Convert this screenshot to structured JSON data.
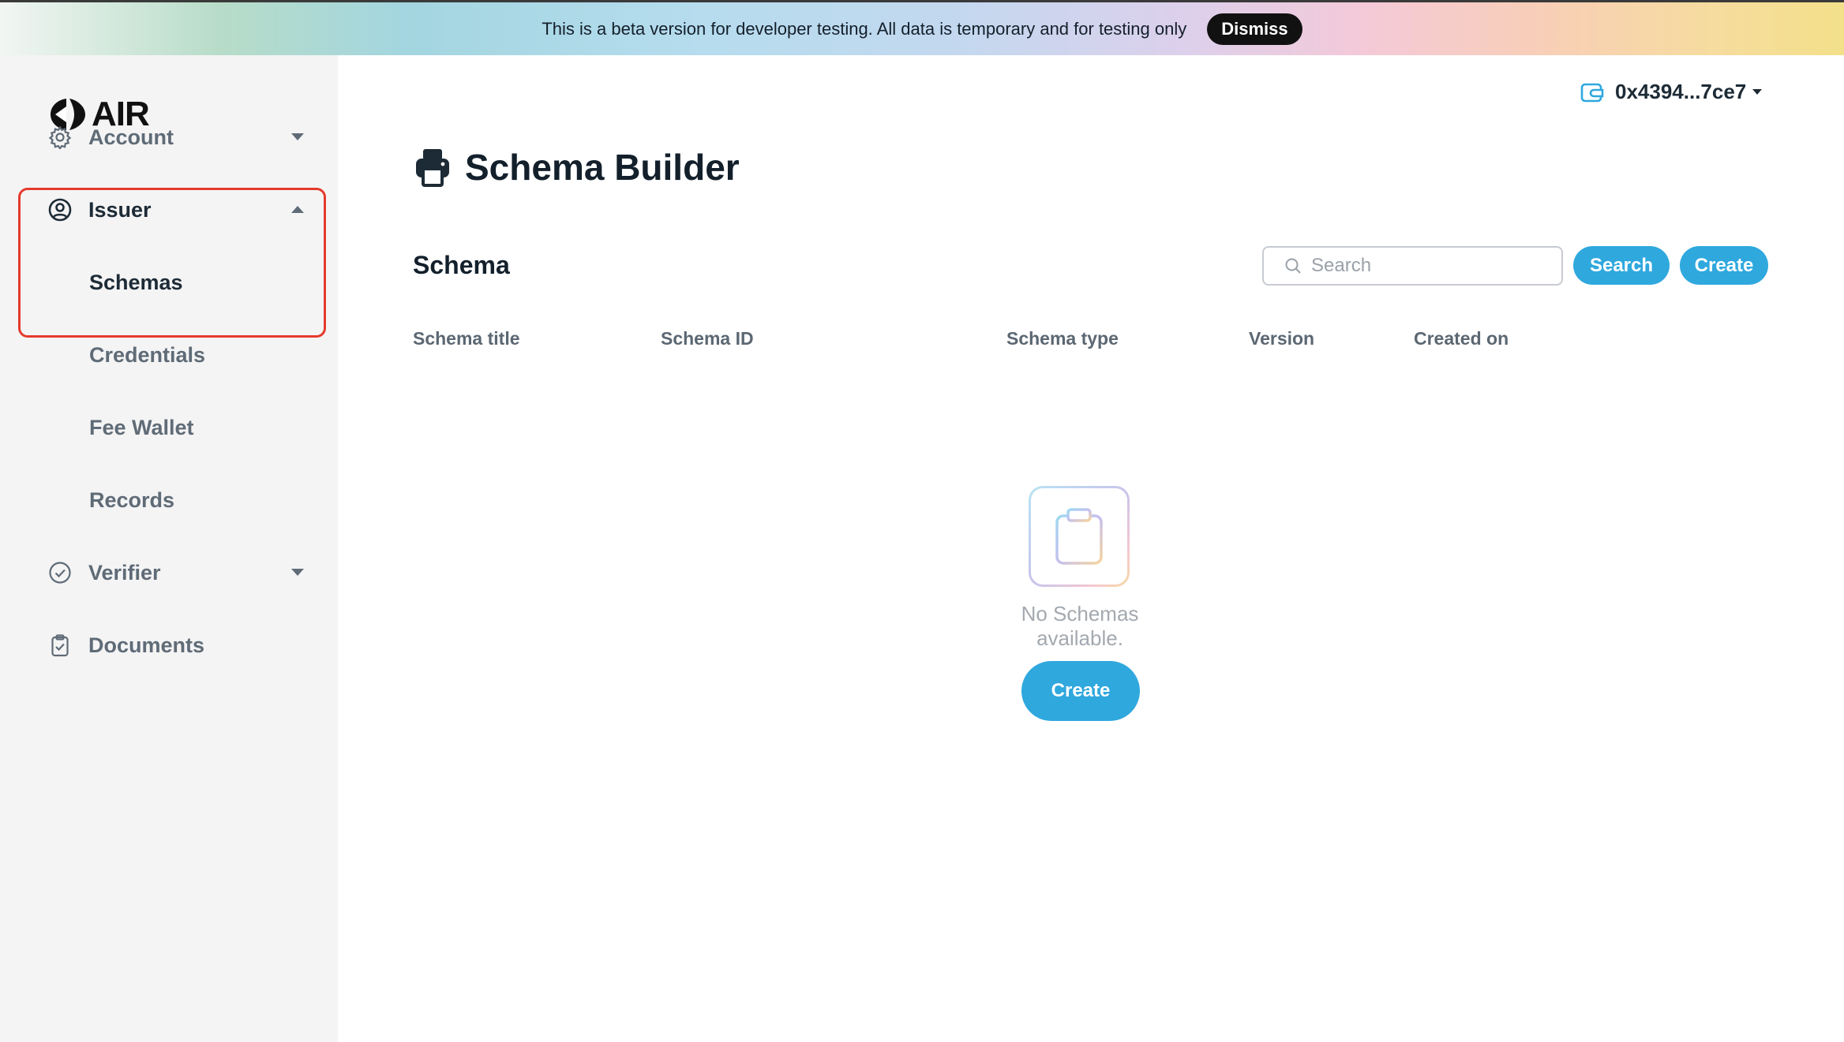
{
  "banner": {
    "text": "This is a beta version for developer testing. All data is temporary and for testing only",
    "dismiss_label": "Dismiss"
  },
  "brand": {
    "name": "AIR"
  },
  "sidebar": {
    "account_label": "Account",
    "issuer_label": "Issuer",
    "issuer_children": {
      "schemas": "Schemas",
      "credentials": "Credentials",
      "fee_wallet": "Fee Wallet",
      "records": "Records"
    },
    "verifier_label": "Verifier",
    "documents_label": "Documents"
  },
  "wallet": {
    "address": "0x4394...7ce7"
  },
  "page": {
    "title": "Schema Builder"
  },
  "schema_section": {
    "title": "Schema",
    "search_placeholder": "Search",
    "search_button": "Search",
    "create_button": "Create",
    "columns": [
      "Schema title",
      "Schema ID",
      "Schema type",
      "Version",
      "Created on"
    ],
    "empty_message": "No Schemas available.",
    "empty_create_button": "Create"
  },
  "colors": {
    "accent": "#2fa8de",
    "highlight": "#e53a2c",
    "sidebar_bg": "#f4f4f5"
  }
}
